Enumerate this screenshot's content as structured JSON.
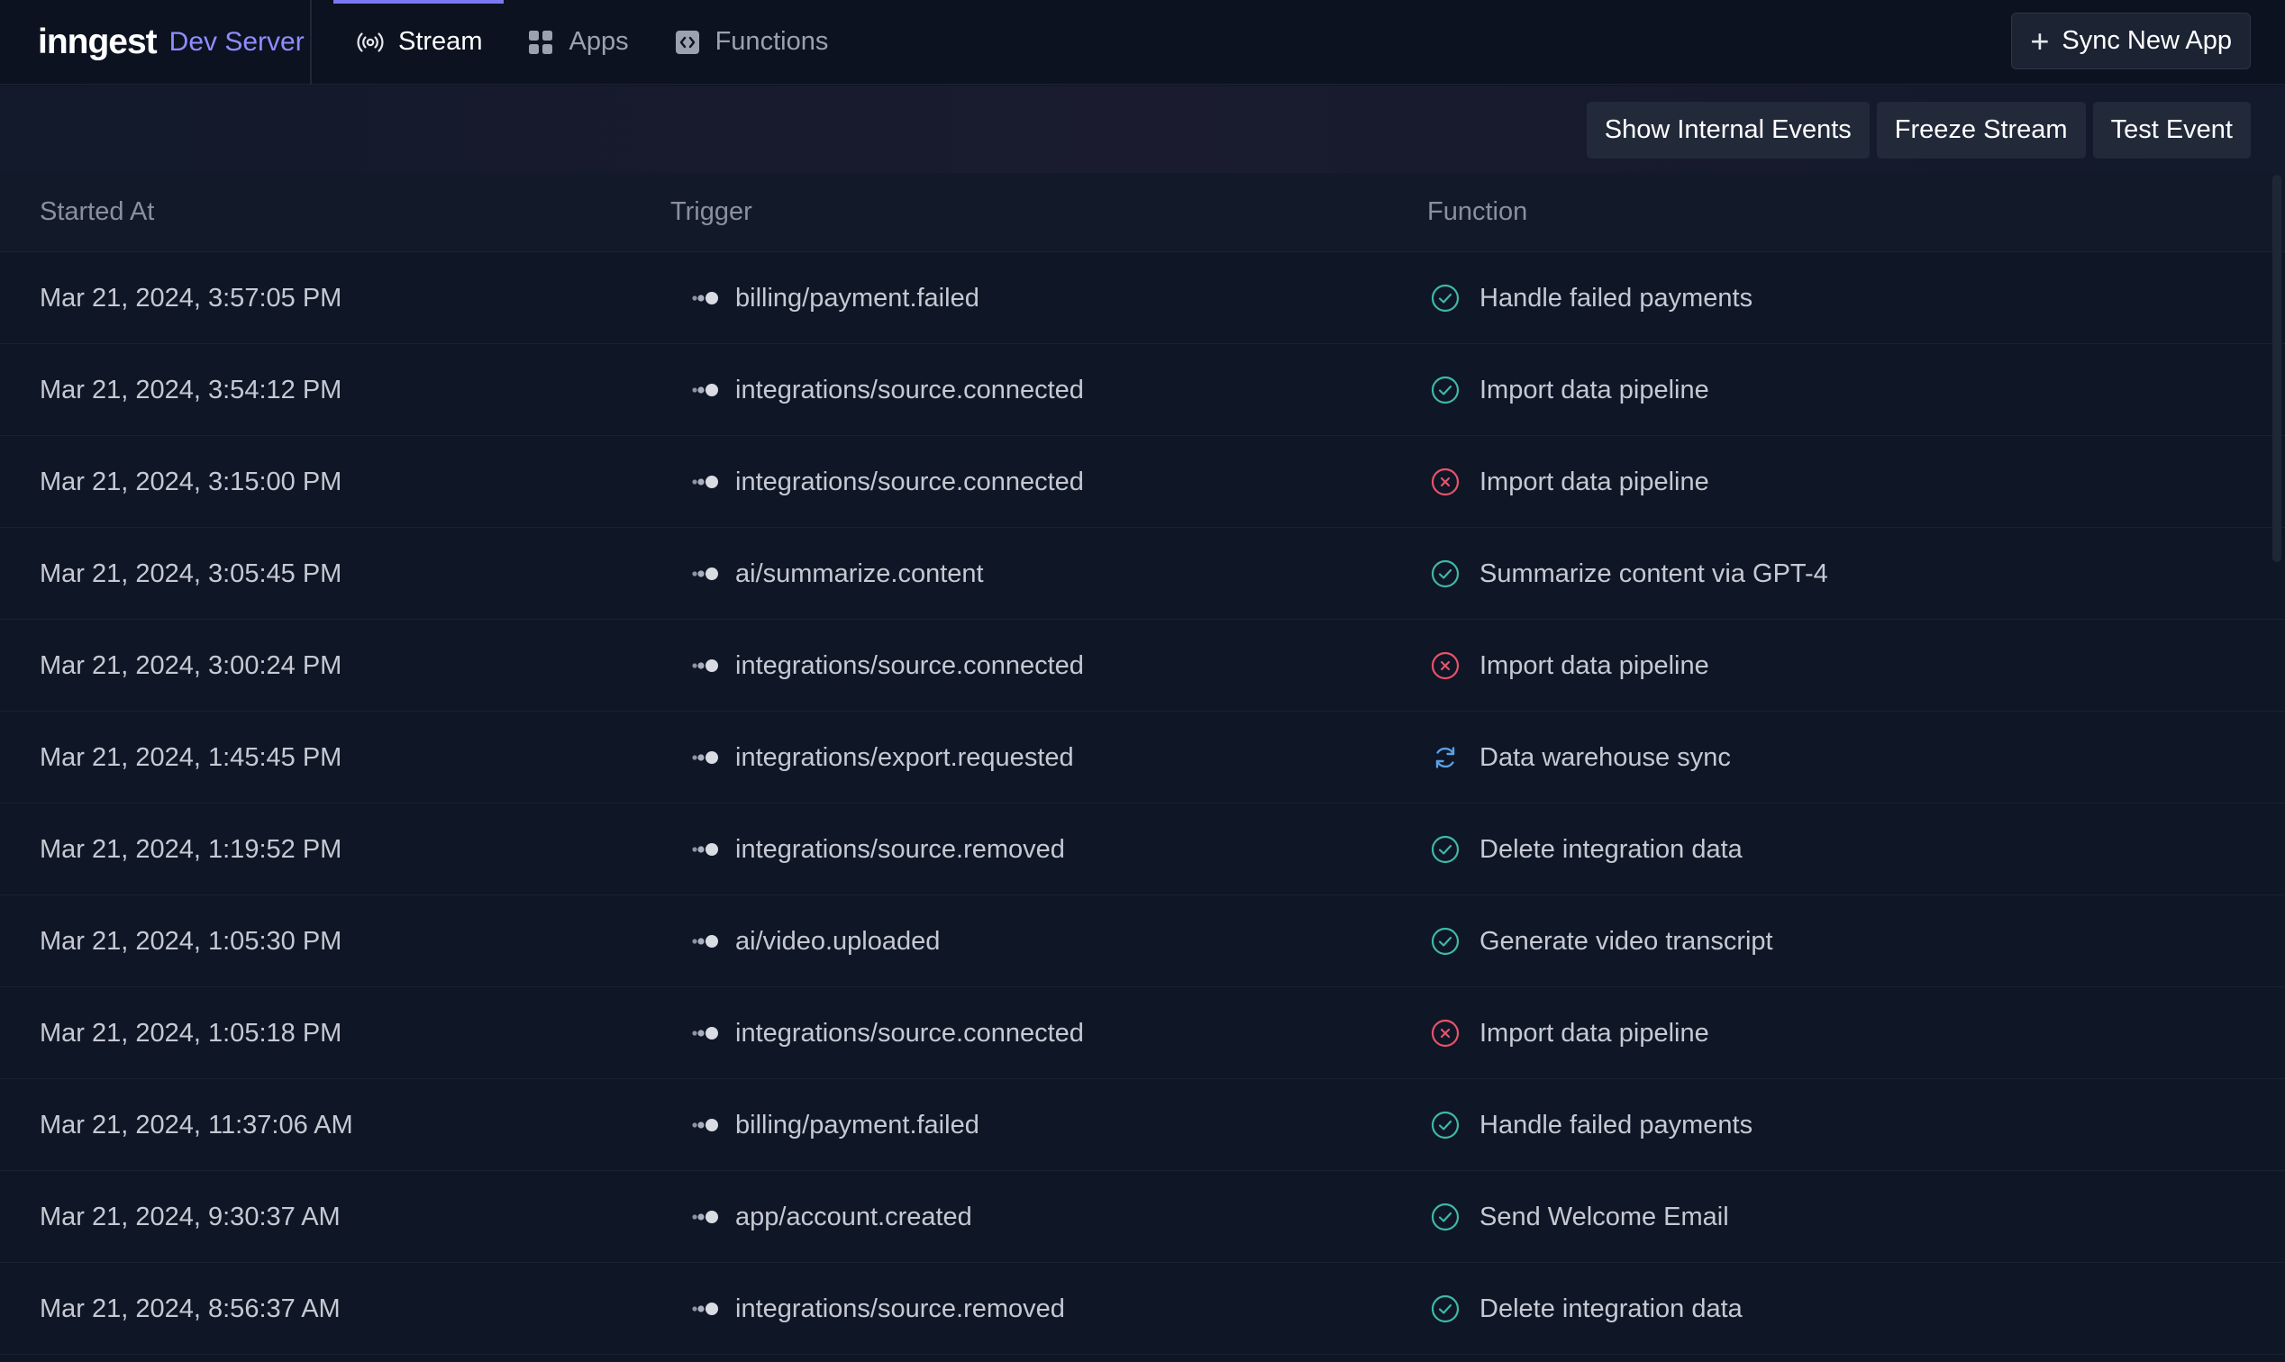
{
  "brand": {
    "logo": "inngest",
    "subtitle": "Dev Server"
  },
  "nav": {
    "items": [
      {
        "label": "Stream",
        "icon": "stream-icon",
        "active": true
      },
      {
        "label": "Apps",
        "icon": "apps-grid-icon",
        "active": false
      },
      {
        "label": "Functions",
        "icon": "functions-code-icon",
        "active": false
      }
    ]
  },
  "header": {
    "sync_label": "Sync New App"
  },
  "toolbar": {
    "show_internal_label": "Show Internal Events",
    "freeze_label": "Freeze Stream",
    "test_event_label": "Test Event"
  },
  "table": {
    "columns": {
      "started": "Started At",
      "trigger": "Trigger",
      "function": "Function"
    },
    "rows": [
      {
        "started": "Mar 21, 2024, 3:57:05 PM",
        "trigger": "billing/payment.failed",
        "function": "Handle failed payments",
        "status": "completed"
      },
      {
        "started": "Mar 21, 2024, 3:54:12 PM",
        "trigger": "integrations/source.connected",
        "function": "Import data pipeline",
        "status": "completed"
      },
      {
        "started": "Mar 21, 2024, 3:15:00 PM",
        "trigger": "integrations/source.connected",
        "function": "Import data pipeline",
        "status": "failed"
      },
      {
        "started": "Mar 21, 2024, 3:05:45 PM",
        "trigger": "ai/summarize.content",
        "function": "Summarize content via GPT-4",
        "status": "completed"
      },
      {
        "started": "Mar 21, 2024, 3:00:24 PM",
        "trigger": "integrations/source.connected",
        "function": "Import data pipeline",
        "status": "failed"
      },
      {
        "started": "Mar 21, 2024, 1:45:45 PM",
        "trigger": "integrations/export.requested",
        "function": "Data warehouse sync",
        "status": "running"
      },
      {
        "started": "Mar 21, 2024, 1:19:52 PM",
        "trigger": "integrations/source.removed",
        "function": "Delete integration data",
        "status": "completed"
      },
      {
        "started": "Mar 21, 2024, 1:05:30 PM",
        "trigger": "ai/video.uploaded",
        "function": "Generate video transcript",
        "status": "completed"
      },
      {
        "started": "Mar 21, 2024, 1:05:18 PM",
        "trigger": "integrations/source.connected",
        "function": "Import data pipeline",
        "status": "failed"
      },
      {
        "started": "Mar 21, 2024, 11:37:06 AM",
        "trigger": "billing/payment.failed",
        "function": "Handle failed payments",
        "status": "completed"
      },
      {
        "started": "Mar 21, 2024, 9:30:37 AM",
        "trigger": "app/account.created",
        "function": "Send Welcome Email",
        "status": "completed"
      },
      {
        "started": "Mar 21, 2024, 8:56:37 AM",
        "trigger": "integrations/source.removed",
        "function": "Delete integration data",
        "status": "completed"
      }
    ]
  },
  "colors": {
    "accent": "#7b78f0",
    "completed": "#3fb8a4",
    "failed": "#e5536b",
    "running": "#5aa0e6"
  }
}
